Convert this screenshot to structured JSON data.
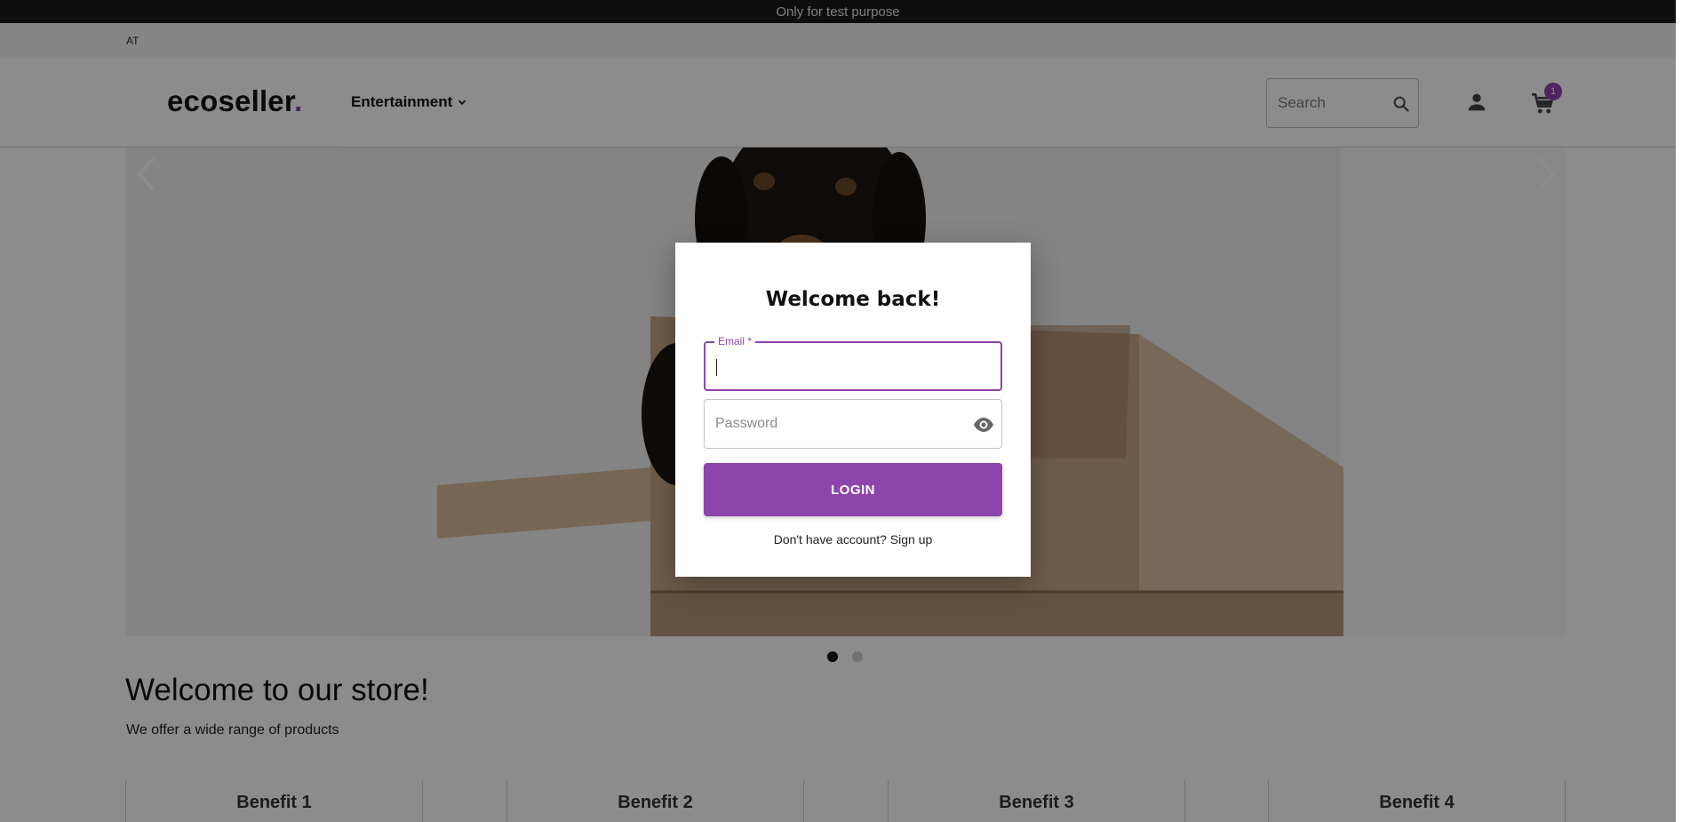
{
  "topbar": {
    "notice": "Only for test purpose"
  },
  "locale": {
    "code": "AT"
  },
  "header": {
    "logo_text": "ecoseller",
    "logo_dot": ".",
    "nav_label": "Entertainment",
    "search_placeholder": "Search",
    "cart_count": "1"
  },
  "carousel": {
    "slides": 2,
    "active_slide": 1
  },
  "welcome": {
    "title": "Welcome to our store!",
    "subtitle": "We offer a wide range of products"
  },
  "benefits": [
    "Benefit 1",
    "Benefit 2",
    "Benefit 3",
    "Benefit 4"
  ],
  "login_modal": {
    "title": "Welcome back!",
    "email_label": "Email *",
    "email_value": "",
    "password_placeholder": "Password",
    "login_label": "LOGIN",
    "signup_prompt": "Don't have account?",
    "signup_link": "Sign up"
  },
  "colors": {
    "accent": "#8e44ad",
    "topbar_bg": "#1a1a1a",
    "overlay": "rgba(0,0,0,0.45)"
  },
  "icons": [
    "chevron-down-icon",
    "search-icon",
    "account-icon",
    "cart-icon",
    "chevron-left-icon",
    "chevron-right-icon",
    "eye-icon"
  ]
}
